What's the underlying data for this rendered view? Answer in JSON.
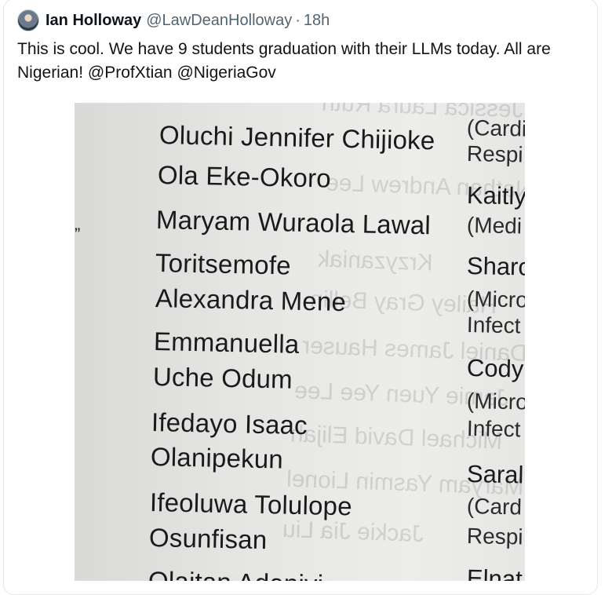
{
  "tweet": {
    "display_name": "Ian Holloway",
    "handle": "@LawDeanHolloway",
    "separator": "·",
    "timestamp": "18h",
    "text_before": "This is cool. We have 9 students graduation with their LLMs today. All are Nigerian! ",
    "mention_1": "@ProfXtian",
    "mention_2": "@NigeriaGov",
    "avatar_icon": "user-avatar-photo"
  },
  "photo": {
    "left_column": [
      "Oluchi Jennifer Chijioke",
      "Ola Eke-Okoro",
      "Maryam Wuraola Lawal",
      "Toritsemofe",
      "Alexandra Mene",
      "Emmanuella",
      "Uche Odum",
      "Ifedayo Isaac",
      "Olanipekun",
      "Ifeoluwa Tolulope",
      "Osunfisan",
      "Olaitan Adeniyi"
    ],
    "right_column": [
      "(Cardi",
      "Respi",
      "Kaitly",
      "(Medi",
      "Sharc",
      "(Micro",
      "Infect",
      "Cody",
      "(Micro",
      "Infect",
      "Saral",
      "(Card",
      "Respi",
      "Elnat"
    ],
    "left_mark": "”",
    "bleed_through": [
      "Jessica Laura Ruth",
      "Nathan Andrew Lee",
      "Krzyzaniak",
      "Hailey Gray Bellin",
      "Daniel James Hauser",
      "Jamie Yuen Yee Lee",
      "Michael David Elijah",
      "Maryam Yasmin Lionel",
      "Jackie Jia Liu"
    ]
  }
}
